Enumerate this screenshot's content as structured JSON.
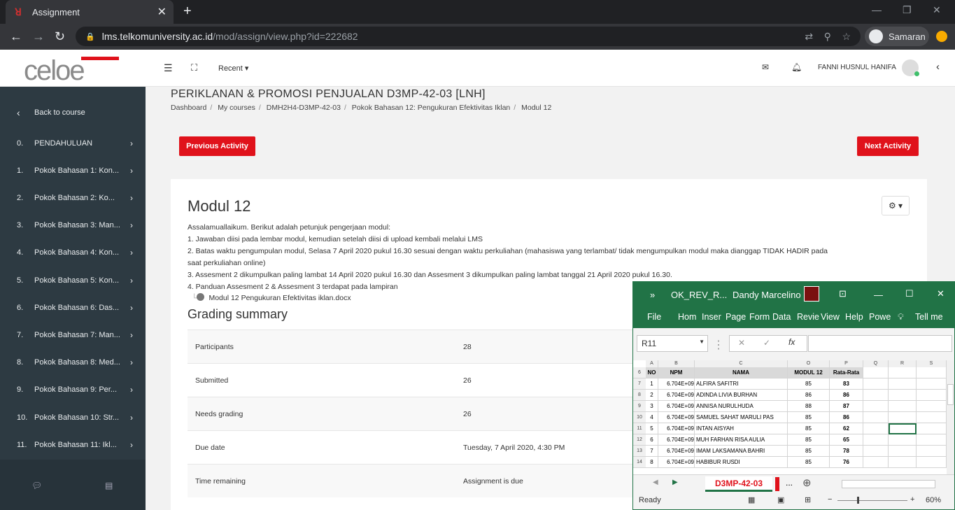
{
  "browser": {
    "tab_title": "Assignment",
    "url_host": "lms.telkomuniversity.ac.id",
    "url_path": "/mod/assign/view.php?id=222682",
    "profile_name": "Samaran"
  },
  "topnav": {
    "logo_text": "celoe",
    "recent_label": "Recent",
    "user_name": "FANNI HUSNUL HANIFA"
  },
  "sidebar": {
    "back_label": "Back to course",
    "items": [
      {
        "num": "0.",
        "label": "PENDAHULUAN"
      },
      {
        "num": "1.",
        "label": "Pokok Bahasan 1: Kon..."
      },
      {
        "num": "2.",
        "label": "Pokok Bahasan 2: Ko..."
      },
      {
        "num": "3.",
        "label": "Pokok Bahasan 3: Man..."
      },
      {
        "num": "4.",
        "label": "Pokok Bahasan 4: Kon..."
      },
      {
        "num": "5.",
        "label": "Pokok Bahasan 5: Kon..."
      },
      {
        "num": "6.",
        "label": "Pokok Bahasan 6: Das..."
      },
      {
        "num": "7.",
        "label": "Pokok Bahasan 7: Man..."
      },
      {
        "num": "8.",
        "label": "Pokok Bahasan 8: Med..."
      },
      {
        "num": "9.",
        "label": "Pokok Bahasan 9: Per..."
      },
      {
        "num": "10.",
        "label": "Pokok Bahasan 10: Str..."
      },
      {
        "num": "11.",
        "label": "Pokok Bahasan 11: Ikl..."
      }
    ]
  },
  "main": {
    "course_title": "PERIKLANAN & PROMOSI PENJUALAN D3MP-42-03 [LNH]",
    "breadcrumbs": [
      "Dashboard",
      "My courses",
      "DMH2H4-D3MP-42-03",
      "Pokok Bahasan 12: Pengukuran Efektivitas Iklan",
      "Modul 12"
    ],
    "prev_label": "Previous Activity",
    "next_label": "Next Activity",
    "module_title": "Modul 12",
    "instructions": [
      "Assalamuallaikum. Berikut adalah petunjuk pengerjaan modul:",
      " 1. Jawaban diisi pada lembar modul, kemudian setelah diisi di upload kembali melalui LMS",
      " 2. Batas waktu pengumpulan modul, Selasa 7 April 2020 pukul 16.30 sesuai dengan waktu perkuliahan (mahasiswa yang terlambat/ tidak mengumpulkan modul maka dianggap TIDAK HADIR pada",
      "saat perkuliahan online)",
      " 3. Assesment 2 dikumpulkan paling lambat 14 April 2020 pukul 16.30 dan Assesment 3 dikumpulkan paling lambat tanggal 21 April 2020 pukul 16.30.",
      "4.  Panduan Assesment 2 & Assesment 3 terdapat pada lampiran"
    ],
    "attachment": "Modul 12 Pengukuran Efektivitas iklan.docx",
    "grading_title": "Grading summary",
    "grading": [
      {
        "k": "Participants",
        "v": "28"
      },
      {
        "k": "Submitted",
        "v": "26"
      },
      {
        "k": "Needs grading",
        "v": "26"
      },
      {
        "k": "Due date",
        "v": "Tuesday, 7 April 2020, 4:30 PM"
      },
      {
        "k": "Time remaining",
        "v": "Assignment is due"
      }
    ]
  },
  "excel": {
    "file": "OK_REV_R...",
    "user": "Dandy Marcelino",
    "ribbon": [
      "File",
      "Hom",
      "Inser",
      "Page",
      "Form",
      "Data",
      "Revie",
      "View",
      "Help",
      "Powe",
      "Tell me"
    ],
    "namebox": "R11",
    "sheet": "D3MP-42-03",
    "status": "Ready",
    "zoom": "60%",
    "col_letters": [
      "A",
      "B",
      "C",
      "O",
      "P",
      "Q",
      "R",
      "S"
    ],
    "header": [
      "NO",
      "NPM",
      "NAMA",
      "MODUL 12",
      "Rata-Rata"
    ],
    "rows": [
      {
        "r": "7",
        "no": "1",
        "npm": "6.704E+09",
        "nama": "ALFIRA SAFITRI",
        "m": "85",
        "avg": "83"
      },
      {
        "r": "8",
        "no": "2",
        "npm": "6.704E+09",
        "nama": "ADINDA LIVIA BURHAN",
        "m": "86",
        "avg": "86"
      },
      {
        "r": "9",
        "no": "3",
        "npm": "6.704E+09",
        "nama": "ANNISA NURULHUDA",
        "m": "88",
        "avg": "87"
      },
      {
        "r": "10",
        "no": "4",
        "npm": "6.704E+09",
        "nama": "SAMUEL SAHAT MARULI PAS",
        "m": "85",
        "avg": "86"
      },
      {
        "r": "11",
        "no": "5",
        "npm": "6.704E+09",
        "nama": "INTAN AISYAH",
        "m": "85",
        "avg": "62"
      },
      {
        "r": "12",
        "no": "6",
        "npm": "6.704E+09",
        "nama": "MUH FARHAN RISA AULIA",
        "m": "85",
        "avg": "65"
      },
      {
        "r": "13",
        "no": "7",
        "npm": "6.704E+09",
        "nama": "IMAM LAKSAMANA BAHRI",
        "m": "85",
        "avg": "78"
      },
      {
        "r": "14",
        "no": "8",
        "npm": "6.704E+09",
        "nama": "HABIBUR RUSDI",
        "m": "85",
        "avg": "76"
      }
    ]
  }
}
